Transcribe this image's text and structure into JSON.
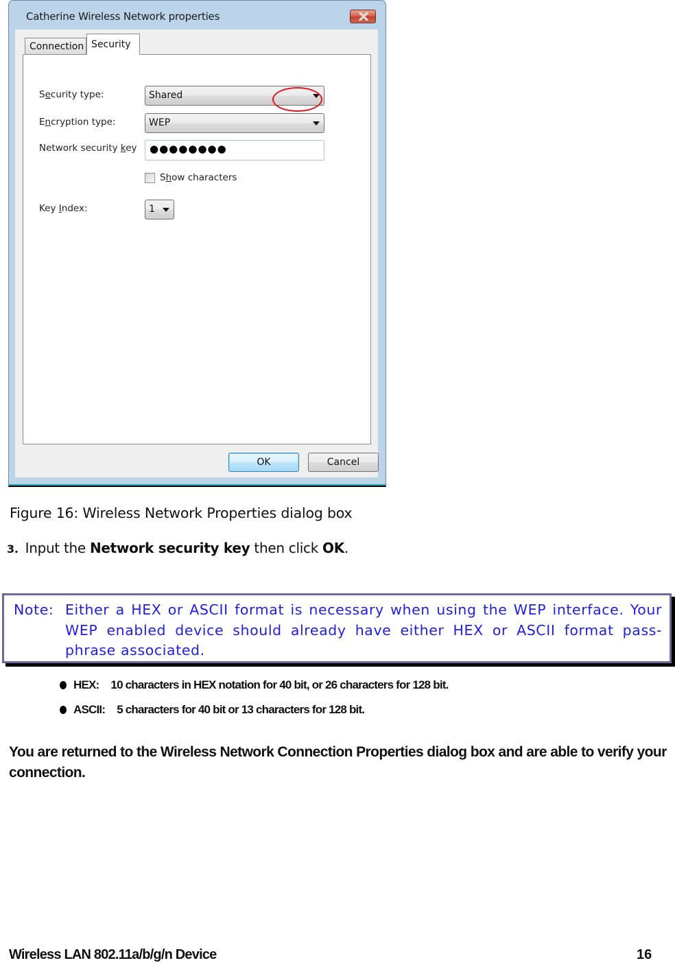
{
  "dialog": {
    "title": "Catherine  Wireless Network properties",
    "close_icon": "close-x-icon",
    "tabs": [
      {
        "label": "Connection",
        "active": false
      },
      {
        "label": "Security",
        "active": true
      }
    ],
    "fields": {
      "security_type": {
        "label_pre": "S",
        "label_accel": "e",
        "label_post": "curity type:",
        "value": "Shared"
      },
      "encryption_type": {
        "label_pre": "E",
        "label_accel": "n",
        "label_post": "cryption type:",
        "value": "WEP"
      },
      "network_key": {
        "label_pre": "Network security ",
        "label_accel": "k",
        "label_post": "ey",
        "value": "●●●●●●●●"
      },
      "show_characters": {
        "label_pre": "S",
        "label_accel": "h",
        "label_post": "ow characters",
        "checked": false
      },
      "key_index": {
        "label_pre": "Key ",
        "label_accel": "I",
        "label_post": "ndex:",
        "value": "1"
      }
    },
    "buttons": {
      "ok": "OK",
      "cancel": "Cancel"
    },
    "annotation_color": "#e8101a"
  },
  "document": {
    "caption": "Figure 16: Wireless Network Properties dialog box",
    "step": {
      "number": "3.",
      "text_1": "Input the ",
      "bold_1": "Network security key",
      "text_2": " then click ",
      "bold_2": "OK",
      "text_3": "."
    },
    "note": {
      "label": "Note:",
      "body": "Either a HEX or ASCII format is necessary when using the WEP interface. Your WEP enabled device should already have either HEX or ASCII format pass-phrase associated.",
      "text_color": "#1f1fe0",
      "border_color": "#6a6b9c"
    },
    "bullets": [
      {
        "key": "HEX:",
        "text": "10 characters in HEX notation for 40 bit, or 26 characters for 128 bit."
      },
      {
        "key": "ASCII:",
        "text": "5 characters for 40 bit or 13 characters for 128 bit."
      }
    ],
    "summary": "You are returned to the Wireless Network Connection Properties dialog box and are able to verify your connection."
  },
  "footer": {
    "product": "Wireless LAN 802.11a/b/g/n Device",
    "page_number": "16"
  }
}
